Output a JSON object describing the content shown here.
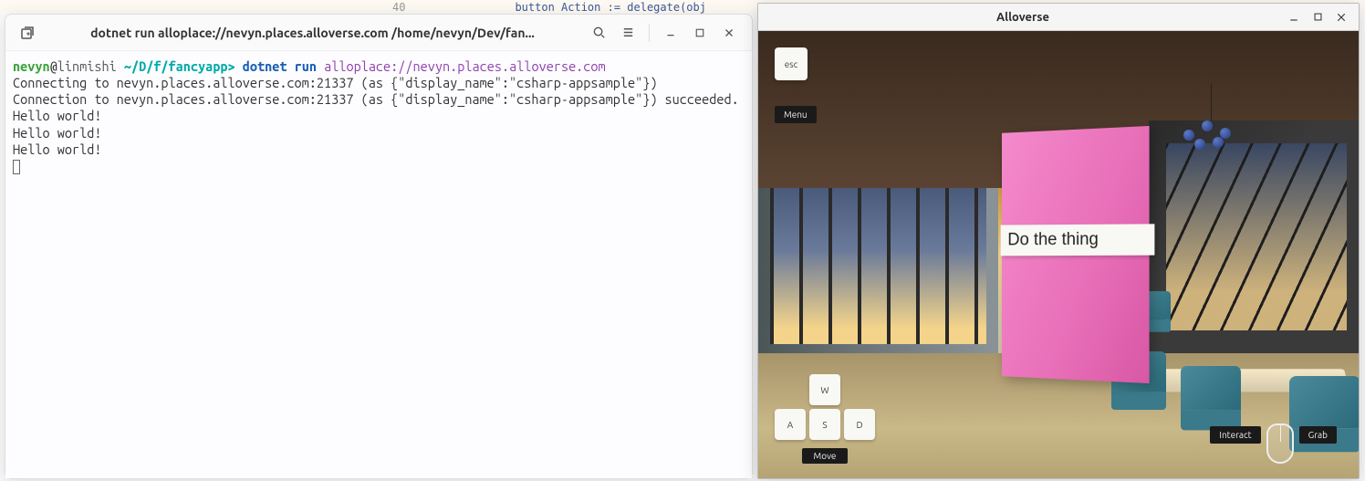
{
  "bg_editor": {
    "line_no": "40",
    "code_fragment": "button Action := delegate(obj"
  },
  "terminal": {
    "title": "dotnet run alloplace://nevyn.places.alloverse.com /home/nevyn/Dev/fan...",
    "prompt": {
      "user": "nevyn",
      "at": "@",
      "host": "linmishi",
      "path_sep": " ~",
      "path": "/D/f/fancyapp",
      "suffix": "> "
    },
    "command": {
      "exe": "dotnet ",
      "sub": "run ",
      "arg_scheme": "alloplace://",
      "arg_host": "nevyn.places.alloverse.com"
    },
    "lines": [
      "Connecting to nevyn.places.alloverse.com:21337 (as {\"display_name\":\"csharp-appsample\"})",
      "Connection to nevyn.places.alloverse.com:21337 (as {\"display_name\":\"csharp-appsample\"}) succeeded.",
      "Hello world!",
      "Hello world!",
      "Hello world!"
    ]
  },
  "alloverse": {
    "title": "Alloverse",
    "hud": {
      "esc": "esc",
      "menu": "Menu",
      "keys": {
        "w": "W",
        "a": "A",
        "s": "S",
        "d": "D"
      },
      "move_label": "Move",
      "interact": "Interact",
      "grab": "Grab"
    },
    "scene": {
      "button_label": "Do the thing"
    }
  }
}
